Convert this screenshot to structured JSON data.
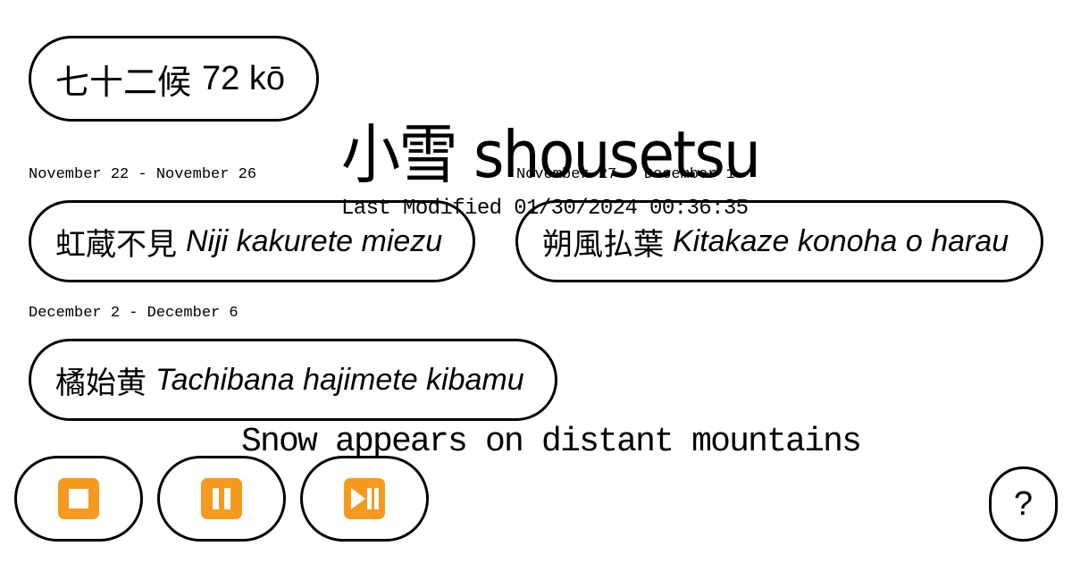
{
  "header": {
    "kanji": "七十二候",
    "label": "72 kō"
  },
  "season": {
    "title": "小雪 shousetsu",
    "last_modified": "Last Modified 01/30/2024 00:36:35",
    "caption": "Snow appears on distant mountains"
  },
  "ko": [
    {
      "dates": "November 22 - November 26",
      "kanji": "虹蔵不見",
      "romaji": "Niji kakurete miezu"
    },
    {
      "dates": "November 27 - December 1",
      "kanji": "朔風払葉",
      "romaji": "Kitakaze konoha o harau"
    },
    {
      "dates": "December 2 - December 6",
      "kanji": "橘始黄",
      "romaji": "Tachibana hajimete kibamu"
    }
  ],
  "controls": {
    "stop_icon": "stop-button-emoji",
    "pause_icon": "pause-button-emoji",
    "play_pause_icon": "play-pause-button-emoji",
    "icon_color": "#f59a1e",
    "help_label": "?"
  }
}
